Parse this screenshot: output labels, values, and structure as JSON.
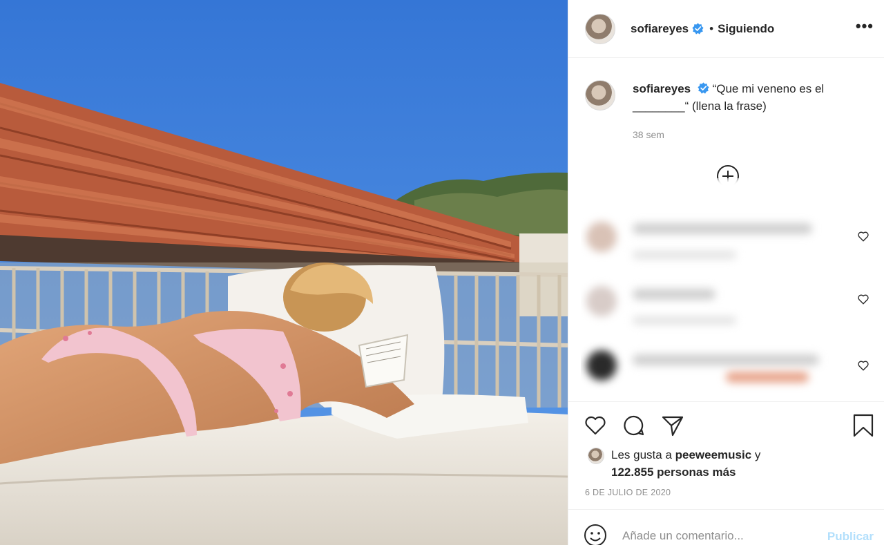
{
  "post": {
    "username": "sofiareyes",
    "follow_status": "Siguiendo",
    "more_label": "•••",
    "dot": "•",
    "caption_line1": "“Que mi veneno es el",
    "caption_line2": "________“ (llena la frase)",
    "time_ago": "38 sem",
    "likes_prefix": "Les gusta a ",
    "likes_user": "peeweemusic",
    "likes_suffix": " y",
    "likes_count": "122.855 personas más",
    "date": "6 DE JULIO DE 2020"
  },
  "comment_box": {
    "placeholder": "Añade un comentario...",
    "publish_label": "Publicar"
  },
  "colors": {
    "sky": "#3c7fd9",
    "verified": "#3897f0",
    "publish_disabled": "#b2dffc",
    "secondary_text": "#8e8e8e"
  },
  "icons": [
    "more-icon",
    "verified-icon",
    "load-more-icon",
    "heart-icon",
    "comment-icon",
    "share-icon",
    "bookmark-icon",
    "emoji-icon"
  ]
}
